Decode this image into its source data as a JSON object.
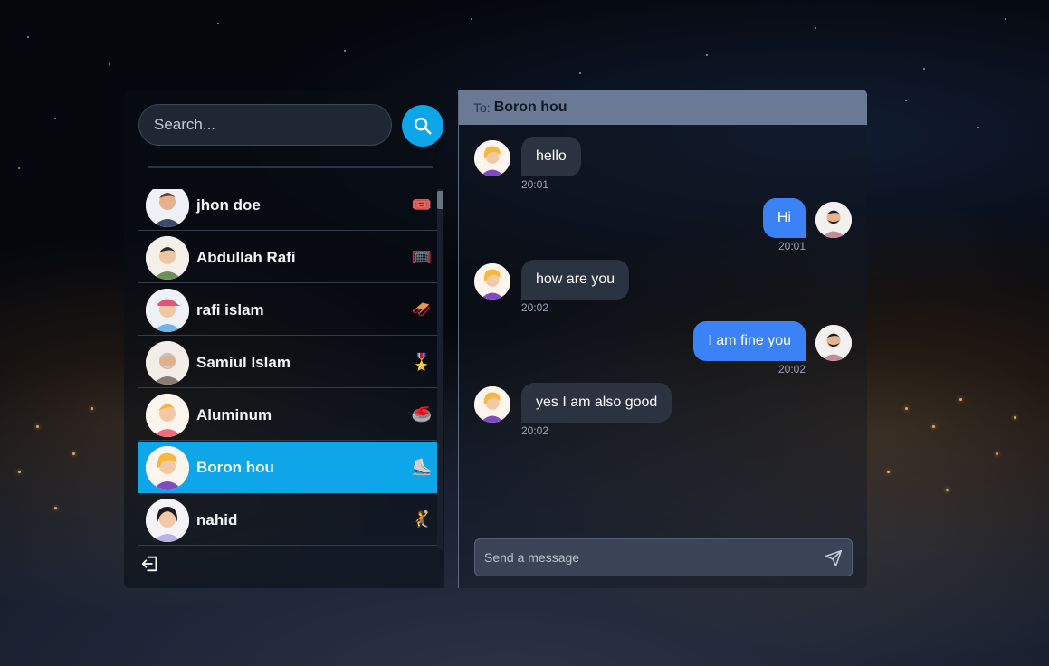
{
  "search": {
    "placeholder": "Search..."
  },
  "icons": {
    "search": "search-icon",
    "logout": "logout-icon",
    "send": "send-icon"
  },
  "colors": {
    "accent": "#0ea5e9",
    "outgoing_bubble": "#3b82f6",
    "incoming_bubble": "#2b3340",
    "chat_header": "#6b7a94"
  },
  "contacts": [
    {
      "name": "jhon doe",
      "emoji": "🎟️",
      "avatar": "man-brown-hair-avatar"
    },
    {
      "name": "Abdullah Rafi",
      "emoji": "🥅",
      "avatar": "man-green-shirt-avatar"
    },
    {
      "name": "rafi islam",
      "emoji": "🛷",
      "avatar": "boy-pink-cap-avatar"
    },
    {
      "name": "Samiul Islam",
      "emoji": "🎖️",
      "avatar": "old-man-grey-hair-avatar"
    },
    {
      "name": "Aluminum",
      "emoji": "🥌",
      "avatar": "woman-pink-sweater-avatar"
    },
    {
      "name": "Boron hou",
      "emoji": "⛸️",
      "avatar": "woman-blonde-hair-avatar",
      "active": true
    },
    {
      "name": "nahid",
      "emoji": "🤾",
      "avatar": "woman-black-hair-avatar"
    }
  ],
  "chat": {
    "to_label": "To:",
    "to_name": "Boron hou",
    "messages": [
      {
        "text": "hello",
        "time": "20:01",
        "direction": "in"
      },
      {
        "text": "Hi",
        "time": "20:01",
        "direction": "out"
      },
      {
        "text": "how are you",
        "time": "20:02",
        "direction": "in"
      },
      {
        "text": "I am fine you",
        "time": "20:02",
        "direction": "out"
      },
      {
        "text": "yes I am also good",
        "time": "20:02",
        "direction": "in"
      }
    ],
    "composer_placeholder": "Send a message"
  }
}
